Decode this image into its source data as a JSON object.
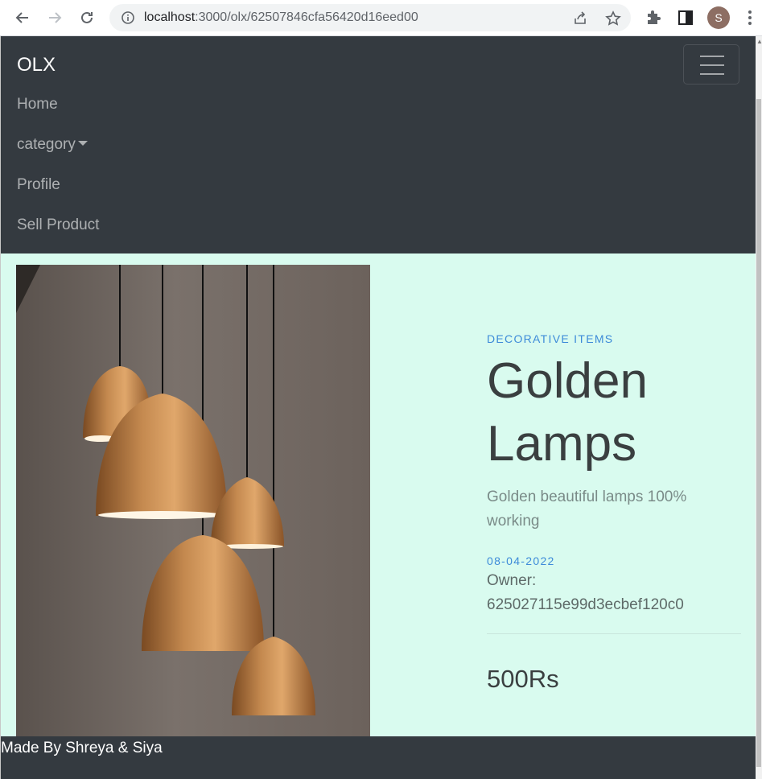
{
  "browser": {
    "url_host": "localhost",
    "url_path": ":3000/olx/62507846cfa56420d16eed00",
    "profile_initial": "S"
  },
  "navbar": {
    "brand": "OLX",
    "links": [
      {
        "label": "Home"
      },
      {
        "label": "category"
      },
      {
        "label": "Profile"
      },
      {
        "label": "Sell Product"
      }
    ]
  },
  "product": {
    "category": "DECORATIVE ITEMS",
    "title_line1": "Golden",
    "title_line2": "Lamps",
    "description": "Golden beautiful lamps 100% working",
    "date": "08-04-2022",
    "owner_label": "Owner:",
    "owner_id": "625027115e99d3ecbef120c0",
    "price": "500Rs"
  },
  "footer": {
    "text": "Made By Shreya & Siya"
  },
  "colors": {
    "navbar_bg": "#343a40",
    "content_bg": "#d9fbef",
    "accent_blue": "#3d8bd9"
  }
}
